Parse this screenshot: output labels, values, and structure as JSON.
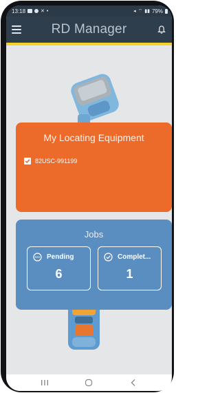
{
  "status_bar": {
    "time": "13:18",
    "battery": "79%"
  },
  "app_bar": {
    "title": "RD Manager",
    "accent_color": "#f3d22a"
  },
  "equipment": {
    "title": "My Locating Equipment",
    "items": [
      {
        "label": "82USC-991199",
        "checked": true
      }
    ],
    "color": "#ec6a2a"
  },
  "jobs": {
    "title": "Jobs",
    "color": "#5b8ec0",
    "tiles": [
      {
        "label": "Pending",
        "count": "6",
        "icon": "ellipsis-circle-icon"
      },
      {
        "label": "Complet...",
        "count": "1",
        "icon": "check-circle-icon"
      }
    ]
  },
  "nav": {
    "recents_icon": "recents-icon",
    "home_icon": "home-icon",
    "back_icon": "back-icon"
  }
}
